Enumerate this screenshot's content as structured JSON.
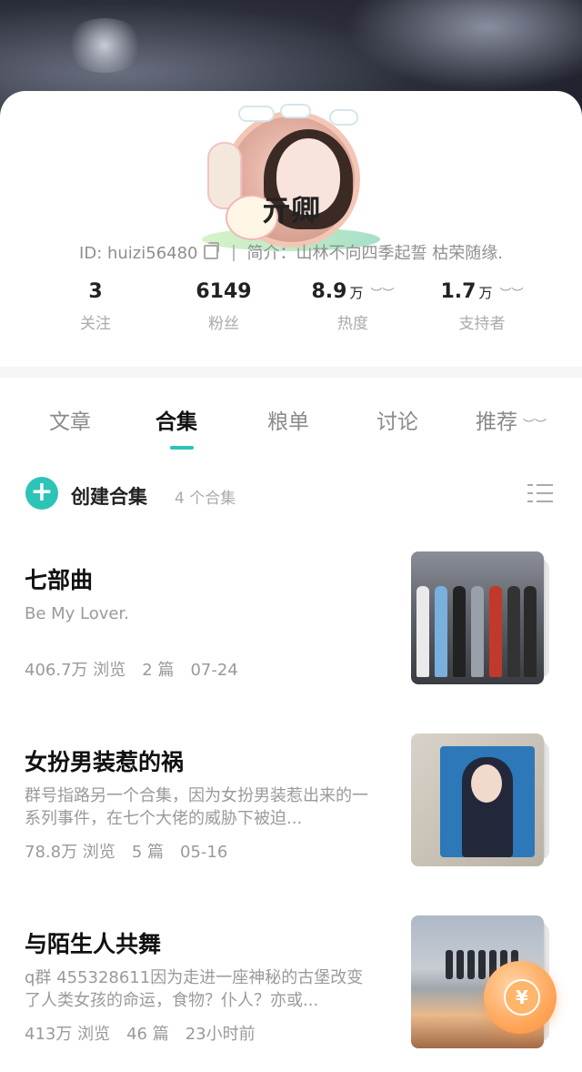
{
  "profile": {
    "name": "亓卿",
    "id_text": "ID: huizi56480",
    "bio": "简介：山林不向四季起誓 枯荣随缘."
  },
  "stats": [
    {
      "value": "3",
      "unit": "",
      "label": "关注"
    },
    {
      "value": "6149",
      "unit": "",
      "label": "粉丝"
    },
    {
      "value": "8.9",
      "unit": "万",
      "label": "热度"
    },
    {
      "value": "1.7",
      "unit": "万",
      "label": "支持者"
    }
  ],
  "tabs": [
    "文章",
    "合集",
    "粮单",
    "讨论",
    "推荐"
  ],
  "active_tab": "合集",
  "collections_header": {
    "create_label": "创建合集",
    "count_label": "4 个合集"
  },
  "collections": [
    {
      "title": "七部曲",
      "desc": "Be My Lover.",
      "views": "406.7万 浏览",
      "chapters": "2 篇",
      "date": "07-24"
    },
    {
      "title": "女扮男装惹的祸",
      "desc": "群号指路另一个合集，因为女扮男装惹出来的一系列事件，在七个大佬的威胁下被迫...",
      "views": "78.8万 浏览",
      "chapters": "5 篇",
      "date": "05-16"
    },
    {
      "title": "与陌生人共舞",
      "desc": "q群 455328611因为走进一座神秘的古堡改变了人类女孩的命运，食物？仆人？亦或...",
      "views": "413万 浏览",
      "chapters": "46 篇",
      "date": "23小时前"
    }
  ],
  "fab_symbol": "¥",
  "colors": {
    "accent": "#2bc4b6",
    "fab": "#ff9a4a"
  }
}
